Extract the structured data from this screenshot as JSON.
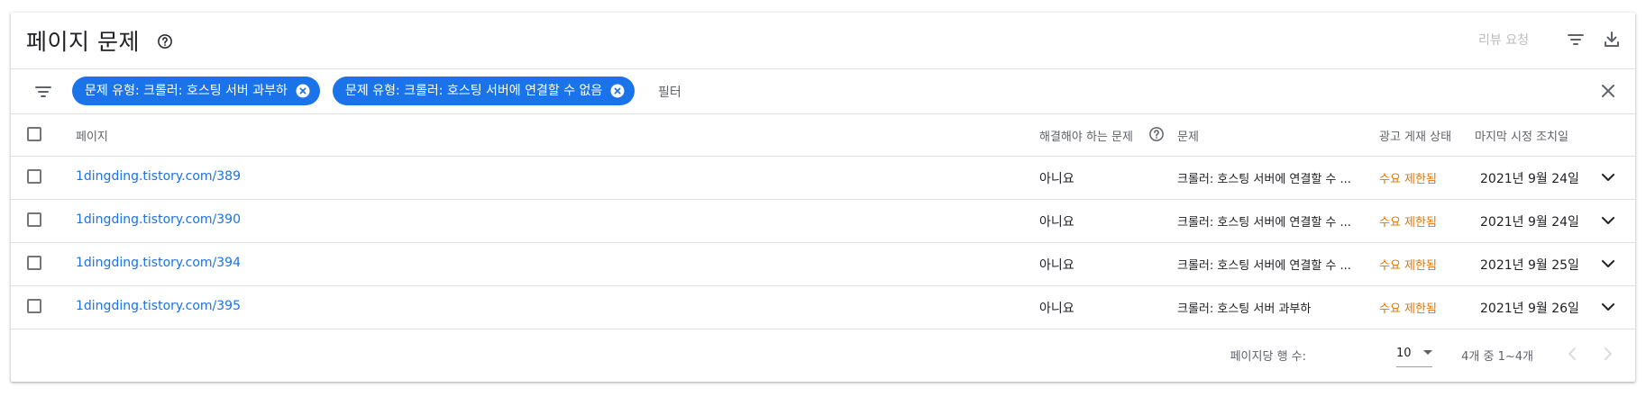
{
  "header": {
    "title": "페이지 문제",
    "review_label": "리뷰 요청"
  },
  "filters": {
    "chips": [
      {
        "label": "문제 유형: 크롤러: 호스팅 서버 과부하"
      },
      {
        "label": "문제 유형: 크롤러: 호스팅 서버에 연결할 수 없음"
      }
    ],
    "placeholder": "필터"
  },
  "table": {
    "columns": {
      "page": "페이지",
      "must_fix": "해결해야 하는 문제",
      "issue": "문제",
      "ad_status": "광고 게재 상태",
      "last_action": "마지막 시정 조치일"
    },
    "rows": [
      {
        "page": "1dingding.tistory.com/389",
        "must_fix": "아니요",
        "issue": "크롤러: 호스팅 서버에 연결할 수 ...",
        "ad_status": "수요 제한됨",
        "date": "2021년 9월 24일"
      },
      {
        "page": "1dingding.tistory.com/390",
        "must_fix": "아니요",
        "issue": "크롤러: 호스팅 서버에 연결할 수 ...",
        "ad_status": "수요 제한됨",
        "date": "2021년 9월 24일"
      },
      {
        "page": "1dingding.tistory.com/394",
        "must_fix": "아니요",
        "issue": "크롤러: 호스팅 서버에 연결할 수 ...",
        "ad_status": "수요 제한됨",
        "date": "2021년 9월 25일"
      },
      {
        "page": "1dingding.tistory.com/395",
        "must_fix": "아니요",
        "issue": "크롤러: 호스팅 서버 과부하",
        "ad_status": "수요 제한됨",
        "date": "2021년 9월 26일"
      }
    ]
  },
  "footer": {
    "rows_per_page_label": "페이지당 행 수:",
    "rows_per_page_value": "10",
    "range": "4개 중 1~4개"
  },
  "colors": {
    "accent": "#1a73e8",
    "status_warning": "#e37400"
  },
  "icons": [
    "help-icon",
    "filter-icon",
    "download-icon",
    "close-icon",
    "chevron-down-icon",
    "chevron-left-icon",
    "chevron-right-icon"
  ]
}
